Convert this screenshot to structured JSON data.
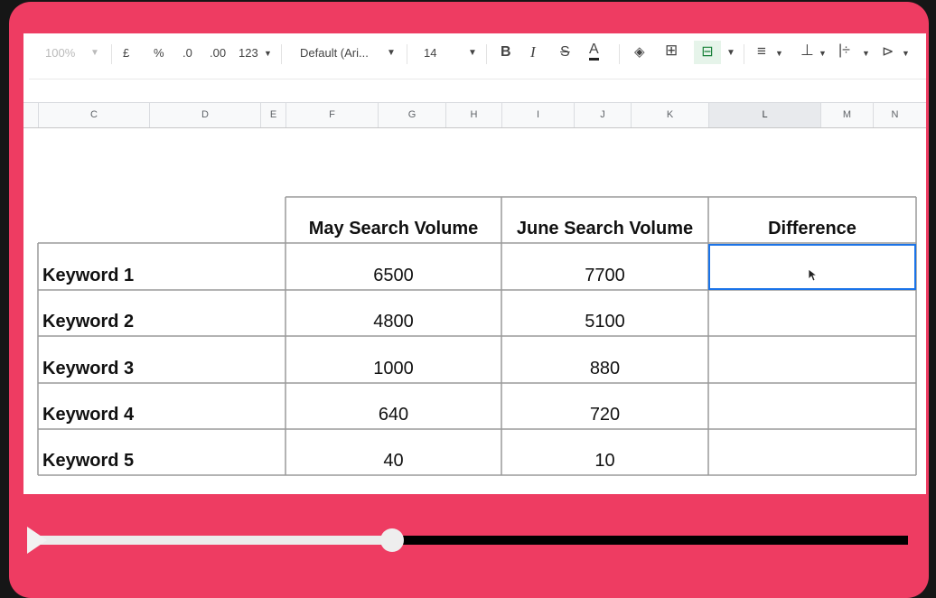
{
  "toolbar": {
    "zoom": "100%",
    "currency": "£",
    "percent": "%",
    "decrease_decimal": ".0",
    "increase_decimal": ".00",
    "more_formats": "123",
    "font": "Default (Ari...",
    "font_size": "14",
    "bold": "B",
    "italic": "I",
    "strike": "S",
    "text_color": "A"
  },
  "columns": [
    "C",
    "D",
    "E",
    "F",
    "G",
    "H",
    "I",
    "J",
    "K",
    "L",
    "M",
    "N"
  ],
  "table": {
    "headers": [
      "May Search Volume",
      "June Search Volume",
      "Difference"
    ],
    "rows": [
      {
        "keyword": "Keyword 1",
        "may": "6500",
        "june": "7700",
        "diff": ""
      },
      {
        "keyword": "Keyword 2",
        "may": "4800",
        "june": "5100",
        "diff": ""
      },
      {
        "keyword": "Keyword 3",
        "may": "1000",
        "june": "880",
        "diff": ""
      },
      {
        "keyword": "Keyword 4",
        "may": "640",
        "june": "720",
        "diff": ""
      },
      {
        "keyword": "Keyword 5",
        "may": "40",
        "june": "10",
        "diff": ""
      }
    ]
  },
  "player": {
    "progress": 0.41
  },
  "colors": {
    "frame": "#ee3c62",
    "selection": "#1a73e8"
  }
}
